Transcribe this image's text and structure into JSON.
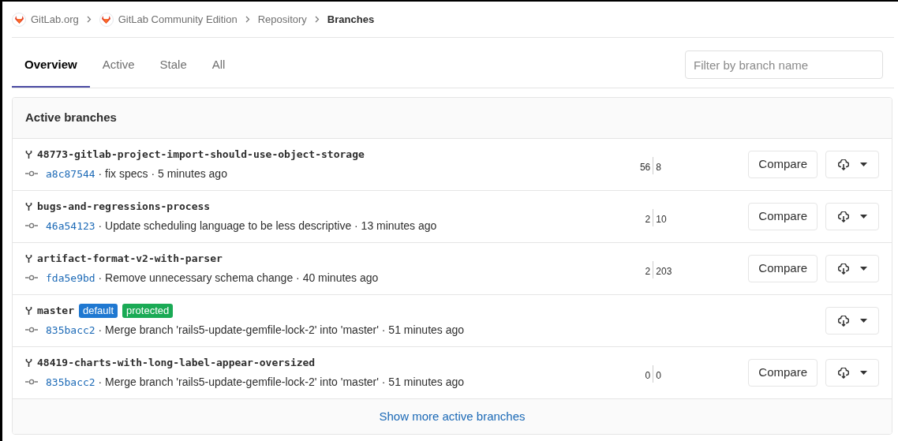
{
  "breadcrumbs": [
    {
      "label": "GitLab.org",
      "current": false
    },
    {
      "label": "GitLab Community Edition",
      "current": false
    },
    {
      "label": "Repository",
      "current": false
    },
    {
      "label": "Branches",
      "current": true
    }
  ],
  "tabs": [
    {
      "label": "Overview",
      "selected": true
    },
    {
      "label": "Active",
      "selected": false
    },
    {
      "label": "Stale",
      "selected": false
    },
    {
      "label": "All",
      "selected": false
    }
  ],
  "filter": {
    "placeholder": "Filter by branch name"
  },
  "panel": {
    "title": "Active branches",
    "branches": [
      {
        "name": "48773-gitlab-project-import-should-use-object-storage",
        "commit": "a8c87544",
        "message": " · fix specs · 5 minutes ago",
        "behind": "56",
        "ahead": "8",
        "compare": "Compare"
      },
      {
        "name": "bugs-and-regressions-process",
        "commit": "46a54123",
        "message": " · Update scheduling language to be less descriptive · 13 minutes ago",
        "behind": "2",
        "ahead": "10",
        "compare": "Compare"
      },
      {
        "name": "artifact-format-v2-with-parser",
        "commit": "fda5e9bd",
        "message": " · Remove unnecessary schema change · 40 minutes ago",
        "behind": "2",
        "ahead": "203",
        "compare": "Compare"
      },
      {
        "name": "master",
        "badges": [
          {
            "label": "default",
            "color": "#1f78d1"
          },
          {
            "label": "protected",
            "color": "#1aaa55"
          }
        ],
        "commit": "835bacc2",
        "message": " · Merge branch 'rails5-update-gemfile-lock-2' into 'master' · 51 minutes ago"
      },
      {
        "name": "48419-charts-with-long-label-appear-oversized",
        "commit": "835bacc2",
        "message": " · Merge branch 'rails5-update-gemfile-lock-2' into 'master' · 51 minutes ago",
        "behind": "0",
        "ahead": "0",
        "compare": "Compare"
      }
    ],
    "footer_link": "Show more active branches"
  }
}
